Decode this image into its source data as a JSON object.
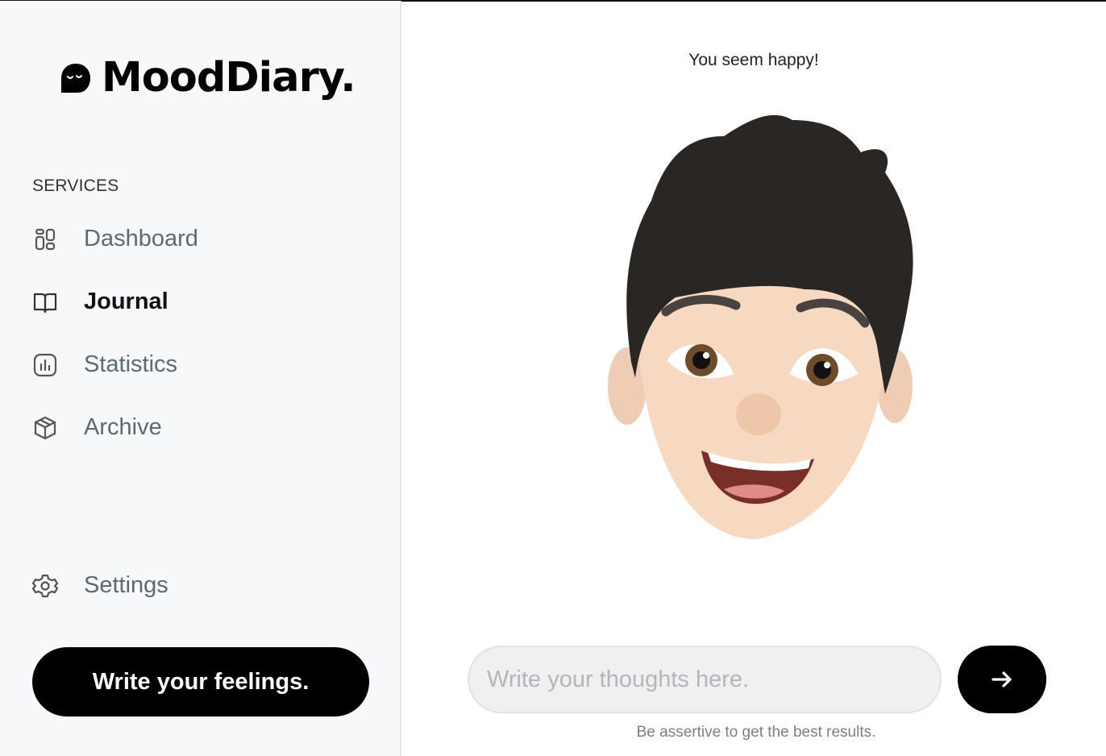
{
  "brand": {
    "name": "MoodDiary.",
    "logo_icon": "ghost-icon"
  },
  "sidebar": {
    "section_label": "SERVICES",
    "items": [
      {
        "label": "Dashboard",
        "icon": "dashboard-icon",
        "active": false
      },
      {
        "label": "Journal",
        "icon": "book-icon",
        "active": true
      },
      {
        "label": "Statistics",
        "icon": "chart-icon",
        "active": false
      },
      {
        "label": "Archive",
        "icon": "box-icon",
        "active": false
      }
    ],
    "settings": {
      "label": "Settings",
      "icon": "gear-icon"
    },
    "cta_label": "Write your feelings."
  },
  "main": {
    "status_text": "You seem happy!",
    "avatar": "happy-memoji-avatar",
    "input": {
      "value": "",
      "placeholder": "Write your thoughts here."
    },
    "send_icon": "arrow-right-icon",
    "hint": "Be assertive to get the best results."
  },
  "colors": {
    "accent": "#000000",
    "sidebar_bg": "#f7f8fa",
    "inactive_text": "#606872"
  }
}
